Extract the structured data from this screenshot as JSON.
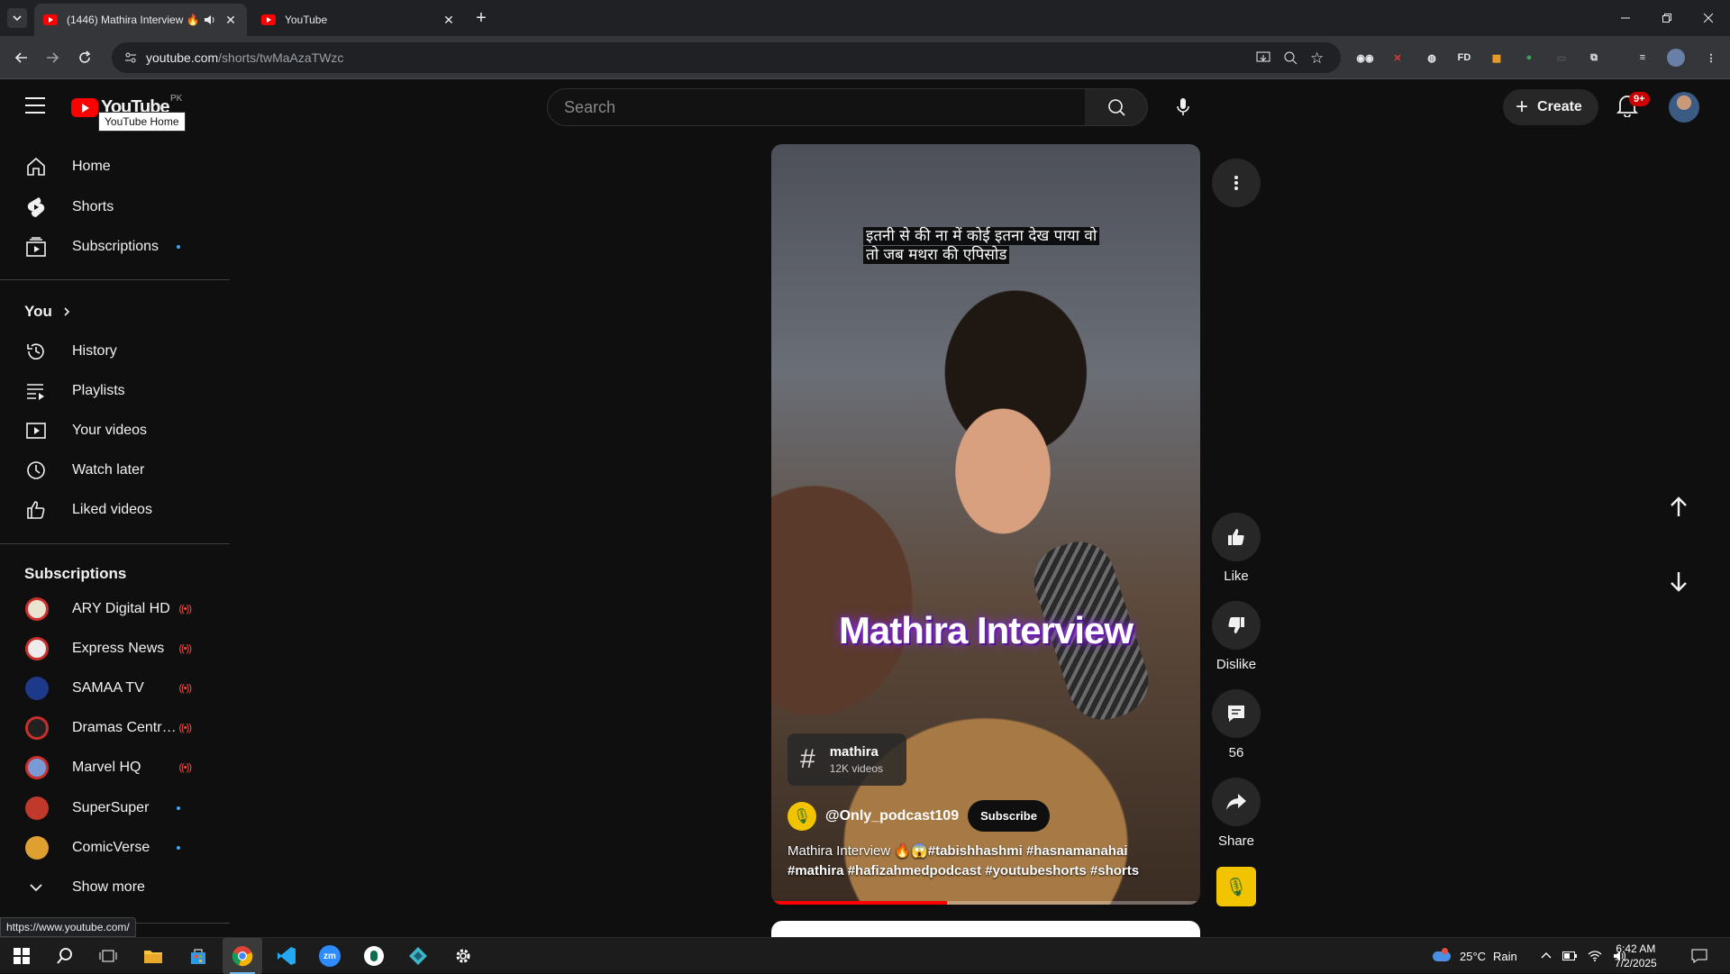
{
  "browser": {
    "tabs": [
      {
        "title": "(1446) Mathira Interview 🔥",
        "active": true
      },
      {
        "title": "YouTube",
        "active": false
      }
    ],
    "url_host": "youtube.com",
    "url_path": "/shorts/twMaAzaTWzc",
    "ext_fd_label": "FD",
    "status_url": "https://www.youtube.com/"
  },
  "header": {
    "logo_text": "YouTube",
    "country_code": "PK",
    "logo_tooltip": "YouTube Home",
    "search_placeholder": "Search",
    "create_label": "Create",
    "notif_badge": "9+"
  },
  "sidebar": {
    "main": [
      {
        "label": "Home",
        "icon": "home-icon"
      },
      {
        "label": "Shorts",
        "icon": "shorts-icon"
      },
      {
        "label": "Subscriptions",
        "icon": "subscriptions-icon"
      }
    ],
    "you_heading": "You",
    "you_items": [
      {
        "label": "History",
        "icon": "history-icon"
      },
      {
        "label": "Playlists",
        "icon": "playlists-icon"
      },
      {
        "label": "Your videos",
        "icon": "your-videos-icon"
      },
      {
        "label": "Watch later",
        "icon": "watch-later-icon"
      },
      {
        "label": "Liked videos",
        "icon": "liked-videos-icon"
      }
    ],
    "subs_heading": "Subscriptions",
    "channels": [
      {
        "name": "ARY Digital HD",
        "status": "live",
        "color": "#e9e3d0"
      },
      {
        "name": "Express News",
        "status": "live",
        "color": "#ececec"
      },
      {
        "name": "SAMAA TV",
        "status": "live",
        "color": "#1d3a8a"
      },
      {
        "name": "Dramas Central ...",
        "status": "live",
        "color": "#222222"
      },
      {
        "name": "Marvel HQ",
        "status": "live",
        "color": "#7a9ad6"
      },
      {
        "name": "SuperSuper",
        "status": "new",
        "color": "#c0392b"
      },
      {
        "name": "ComicVerse",
        "status": "new",
        "color": "#e0a030"
      }
    ],
    "live_glyph": "((•))",
    "show_more": "Show more"
  },
  "short": {
    "caption_line1": "इतनी से की ना में कोई इतना देख पाया वो",
    "caption_line2": "तो जब मथरा की एपिसोड",
    "overlay_title": "Mathira Interview",
    "hashtag_symbol": "#",
    "hashtag_name": "mathira",
    "hashtag_count": "12K videos",
    "channel_handle": "@Only_podcast109",
    "subscribe_label": "Subscribe",
    "description_plain": "Mathira Interview 🔥😱",
    "description_tags": "#tabishhashmi #hasnamanahai #mathira #hafizahmedpodcast #youtubeshorts #shorts",
    "progress": 0.41
  },
  "actions": {
    "like_label": "Like",
    "dislike_label": "Dislike",
    "comments_count": "56",
    "share_label": "Share"
  },
  "taskbar": {
    "weather": "25°C",
    "weather_desc": "Rain",
    "time": "6:42 AM",
    "date": "7/2/2025"
  },
  "colors": {
    "accent_red": "#ff0000",
    "background": "#0f0f0f",
    "link_blue": "#3ea6ff",
    "live_red": "#ff4e45"
  }
}
